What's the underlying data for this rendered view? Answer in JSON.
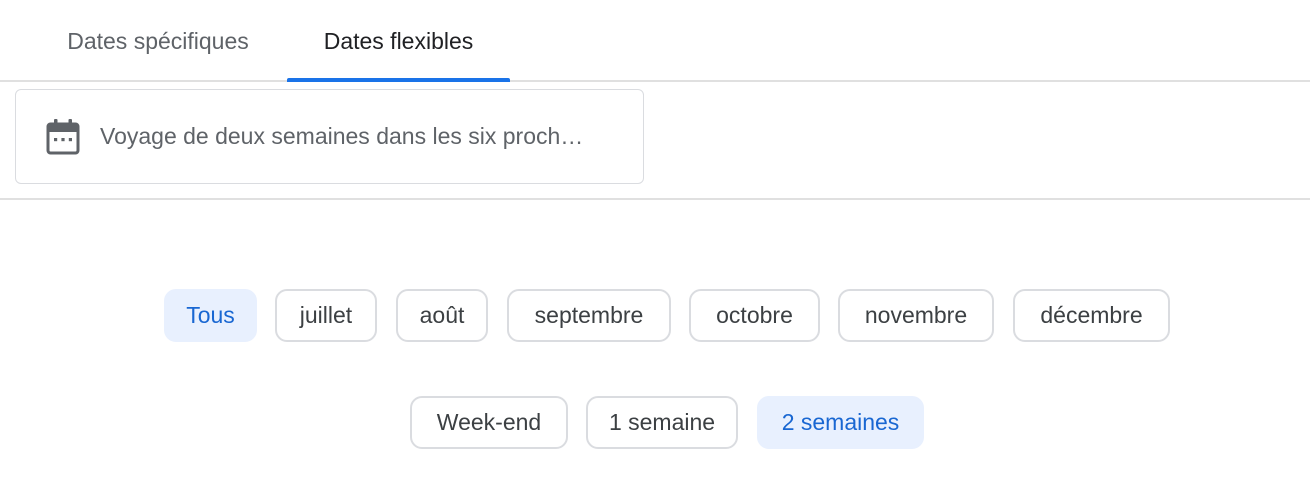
{
  "tabs": {
    "specific_label": "Dates spécifiques",
    "flexible_label": "Dates flexibles",
    "active": "Dates flexibles"
  },
  "search": {
    "icon": "calendar-icon",
    "text": "Voyage de deux semaines dans les six proch…"
  },
  "months": {
    "items": [
      {
        "label": "Tous",
        "selected": true
      },
      {
        "label": "juillet",
        "selected": false
      },
      {
        "label": "août",
        "selected": false
      },
      {
        "label": "septembre",
        "selected": false
      },
      {
        "label": "octobre",
        "selected": false
      },
      {
        "label": "novembre",
        "selected": false
      },
      {
        "label": "décembre",
        "selected": false
      }
    ]
  },
  "durations": {
    "items": [
      {
        "label": "Week-end",
        "selected": false
      },
      {
        "label": "1 semaine",
        "selected": false
      },
      {
        "label": "2 semaines",
        "selected": true
      }
    ]
  },
  "colors": {
    "accent": "#1a73e8",
    "selected_chip_bg": "#e8f0fe",
    "selected_chip_text": "#1967d2",
    "border": "#dadce0",
    "text_secondary": "#5f6368",
    "text_primary": "#202124"
  }
}
